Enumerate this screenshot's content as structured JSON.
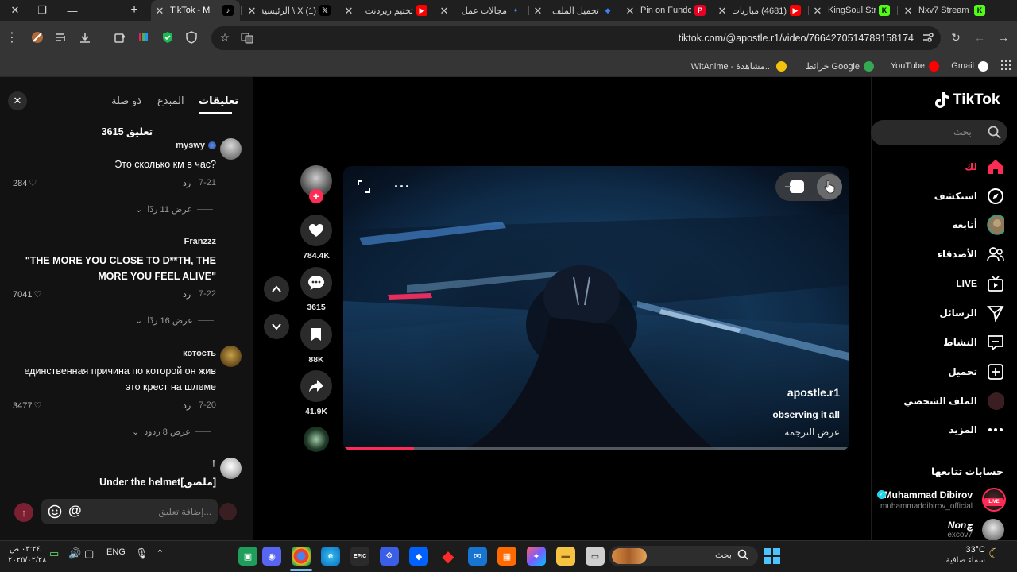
{
  "browser": {
    "tabs": [
      {
        "title": "TikTok - M",
        "active": true,
        "favicon": "tiktok"
      },
      {
        "title": "(1) X \\ الرئيسية",
        "favicon": "x"
      },
      {
        "title": "تختيم ريزدنت",
        "favicon": "youtube"
      },
      {
        "title": "مجالات عمل",
        "favicon": "gemini"
      },
      {
        "title": "تحميل الملف",
        "favicon": "blue-diamond"
      },
      {
        "title": "Pin on Fundo",
        "favicon": "pinterest"
      },
      {
        "title": "(4681) مباريات",
        "favicon": "youtube"
      },
      {
        "title": "KingSoul Stre",
        "favicon": "kick"
      },
      {
        "title": "Nxv7 Stream",
        "favicon": "kick"
      }
    ],
    "new_tab_label": "+",
    "url": "tiktok.com/@apostle.r1/video/7664270514789158174",
    "bookmarks": [
      {
        "label": "Gmail",
        "color": "#ffffff"
      },
      {
        "label": "YouTube",
        "color": "#ff0000"
      },
      {
        "label": "خرائط Google",
        "color": "#34a853"
      },
      {
        "label": "WitAnime - مشاهدة...",
        "color": "#f4c20d"
      }
    ]
  },
  "comments_panel": {
    "tabs": [
      "تعليقات",
      "المبدع",
      "ذو صلة"
    ],
    "count_label": "3615 تعليق",
    "close_label": "✕",
    "comments": [
      {
        "user": "myswy",
        "text": "Это сколько км в час?",
        "date": "7-21",
        "reply": "رد",
        "likes": "284",
        "view_replies": "عرض 11 ردًا"
      },
      {
        "user": "Franzzz",
        "text": "\"THE MORE YOU CLOSE TO D**TH, THE MORE YOU FEEL ALIVE\"",
        "date": "7-22",
        "reply": "رد",
        "likes": "7041",
        "view_replies": "عرض 16 ردًا"
      },
      {
        "user": "котость",
        "text": "единственная причина по которой он жив это крест на шлеме",
        "date": "7-20",
        "reply": "رد",
        "likes": "3477",
        "view_replies": "عرض 8 ردود"
      },
      {
        "user": "†",
        "text": "Under the helmet[ملصق]",
        "date": "",
        "reply": "",
        "likes": "",
        "view_replies": ""
      }
    ],
    "input_placeholder": "إضافة تعليق...",
    "mention_icon": "@"
  },
  "video": {
    "author": "apostle.r1",
    "caption": "observing it all",
    "translate_label": "عرض الترجمة",
    "progress": 0.14
  },
  "actions": {
    "likes": "784.4K",
    "comments": "3615",
    "saves": "88K",
    "shares": "41.9K"
  },
  "sidebar": {
    "brand": "TikTok",
    "search_placeholder": "بحث",
    "nav": [
      {
        "label": "لك",
        "icon": "home-icon"
      },
      {
        "label": "استكشف",
        "icon": "compass-icon"
      },
      {
        "label": "أتابعه",
        "icon": "avatar"
      },
      {
        "label": "الأصدقاء",
        "icon": "friends-icon"
      },
      {
        "label": "LIVE",
        "icon": "live-icon"
      },
      {
        "label": "الرسائل",
        "icon": "send-icon"
      },
      {
        "label": "النشاط",
        "icon": "inbox-icon"
      },
      {
        "label": "تحميل",
        "icon": "plus-box-icon"
      },
      {
        "label": "الملف الشخصي",
        "icon": "profile-avatar"
      },
      {
        "label": "المزيد",
        "icon": "more-icon"
      }
    ],
    "following_title": "حسابات تتابعها",
    "following": [
      {
        "name": "Muhammad Dibirov",
        "handle": "muhammaddibirov_official",
        "verified": true,
        "live": "LIVE"
      },
      {
        "name": "Nonچ",
        "handle": "excov7",
        "verified": false,
        "live": ""
      }
    ]
  },
  "taskbar": {
    "weather_temp": "33°C",
    "weather_text": "سماء صافية",
    "search_label": "بحث",
    "lang": "ENG",
    "time": "٠٣:٢٤ ص",
    "date": "٢٠٢٥/٠٢/٢٨"
  }
}
